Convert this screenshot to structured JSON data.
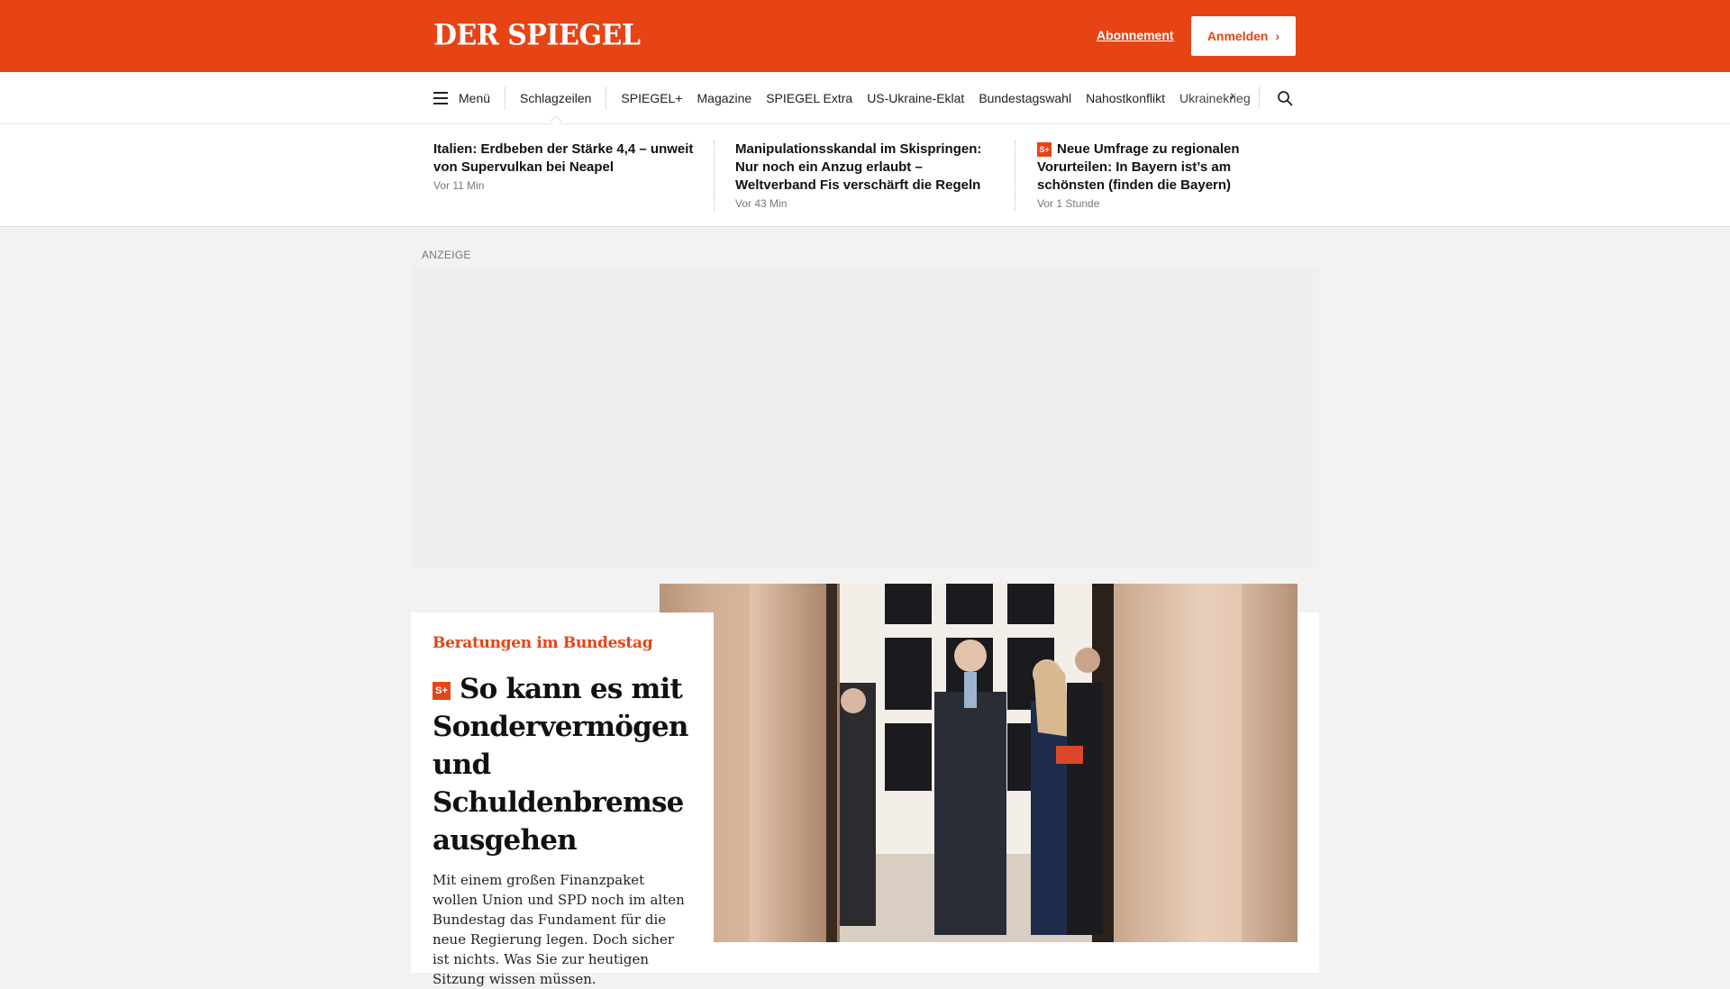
{
  "header": {
    "logo": "DER SPIEGEL",
    "subscription_link": "Abonnement",
    "login_button": "Anmelden",
    "brand_color": "#e64415"
  },
  "nav": {
    "menu_label": "Menü",
    "active_item": "Schlagzeilen",
    "items": [
      "SPIEGEL+",
      "Magazine",
      "SPIEGEL Extra",
      "US-Ukraine-Eklat",
      "Bundestagswahl",
      "Nahostkonflikt",
      "Ukrainekrieg"
    ],
    "more_icon": "chevron-right-icon",
    "search_icon": "search-icon"
  },
  "ticker": [
    {
      "title": "Italien: Erdbeben der Stärke 4,4 – unweit von Supervulkan bei Neapel",
      "time": "Vor 11 Min",
      "spiegel_plus": false
    },
    {
      "title": "Manipulationsskandal im Skispringen: Nur noch ein Anzug erlaubt – Weltverband Fis verschärft die Regeln",
      "time": "Vor 43 Min",
      "spiegel_plus": false
    },
    {
      "title": "Neue Umfrage zu regionalen Vorurteilen: In Bayern ist’s am schönsten (finden die Bayern)",
      "time": "Vor 1 Stunde",
      "spiegel_plus": true
    }
  ],
  "ad": {
    "label": "ANZEIGE"
  },
  "badge": "S+",
  "teaser": {
    "kicker": "Beratungen im Bundestag",
    "headline": "So kann es mit Sondervermögen und Schuldenbremse ausgehen",
    "lead": "Mit einem großen Finanzpaket wollen Union und SPD noch im alten Bundestag das Fundament für die neue Regierung legen. Doch sicher ist nichts. Was Sie zur heutigen Sitzung wissen müssen.",
    "spiegel_plus": true
  }
}
